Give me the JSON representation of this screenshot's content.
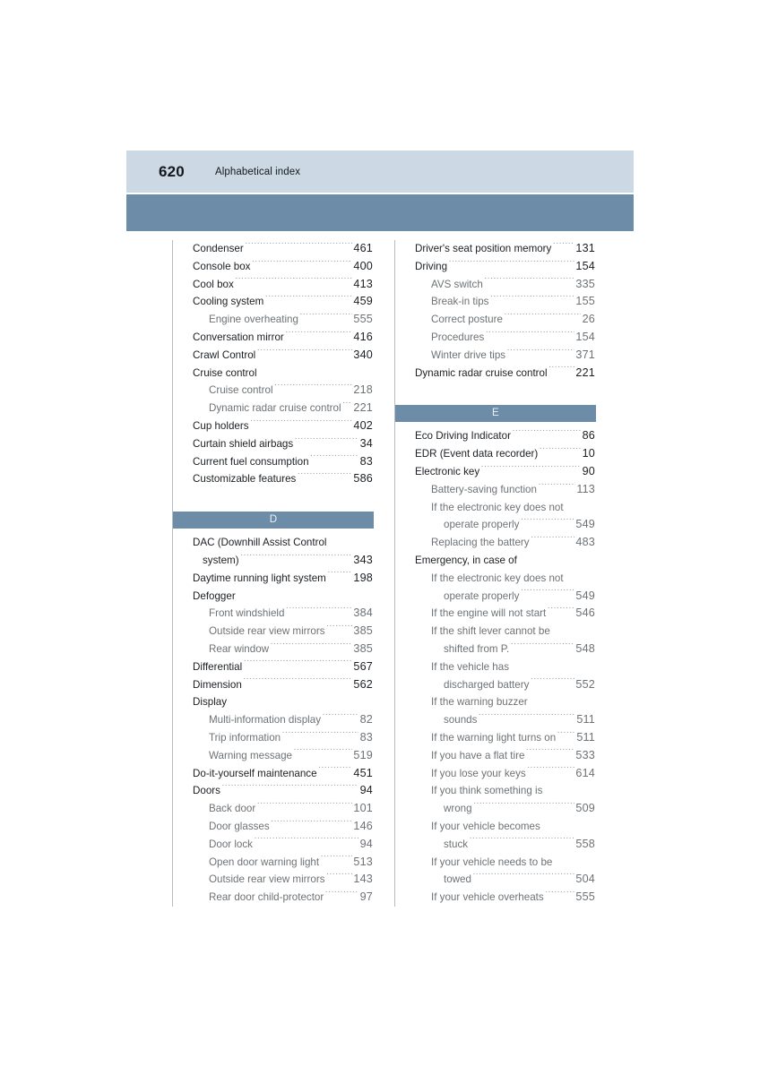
{
  "header": {
    "page_number": "620",
    "title": "Alphabetical index",
    "band_light_color": "#ccd9e4",
    "band_dark_color": "#6d8ca8"
  },
  "columns": [
    {
      "name": "left-column",
      "blocks": [
        {
          "type": "entry",
          "level": 1,
          "text": "Condenser",
          "page": "461"
        },
        {
          "type": "entry",
          "level": 1,
          "text": "Console box",
          "page": "400"
        },
        {
          "type": "entry",
          "level": 1,
          "text": "Cool box",
          "page": "413"
        },
        {
          "type": "entry",
          "level": 1,
          "text": "Cooling system",
          "page": "459"
        },
        {
          "type": "entry",
          "level": 2,
          "text": "Engine overheating",
          "page": "555"
        },
        {
          "type": "entry",
          "level": 1,
          "text": "Conversation mirror",
          "page": "416"
        },
        {
          "type": "entry",
          "level": 1,
          "text": "Crawl Control",
          "page": "340"
        },
        {
          "type": "entry",
          "level": 1,
          "text": "Cruise control",
          "page": ""
        },
        {
          "type": "entry",
          "level": 2,
          "text": "Cruise control",
          "page": "218"
        },
        {
          "type": "entry",
          "level": 2,
          "text": "Dynamic radar cruise control",
          "page": "221"
        },
        {
          "type": "entry",
          "level": 1,
          "text": "Cup holders",
          "page": "402"
        },
        {
          "type": "entry",
          "level": 1,
          "text": "Curtain shield airbags",
          "page": "34"
        },
        {
          "type": "entry",
          "level": 1,
          "text": "Current fuel consumption",
          "page": "83"
        },
        {
          "type": "entry",
          "level": 1,
          "text": "Customizable features",
          "page": "586"
        },
        {
          "type": "letter",
          "letter": "D"
        },
        {
          "type": "entry",
          "level": 1,
          "text": "DAC (Downhill Assist Control",
          "page": ""
        },
        {
          "type": "entry",
          "level": 1,
          "cont": 1,
          "text": "system)",
          "page": "343"
        },
        {
          "type": "entry",
          "level": 1,
          "text": "Daytime running light system",
          "page": "198"
        },
        {
          "type": "entry",
          "level": 1,
          "text": "Defogger",
          "page": ""
        },
        {
          "type": "entry",
          "level": 2,
          "text": "Front windshield",
          "page": "384"
        },
        {
          "type": "entry",
          "level": 2,
          "text": "Outside rear view mirrors",
          "page": "385"
        },
        {
          "type": "entry",
          "level": 2,
          "text": "Rear window",
          "page": "385"
        },
        {
          "type": "entry",
          "level": 1,
          "text": "Differential",
          "page": "567"
        },
        {
          "type": "entry",
          "level": 1,
          "text": "Dimension",
          "page": "562"
        },
        {
          "type": "entry",
          "level": 1,
          "text": "Display",
          "page": ""
        },
        {
          "type": "entry",
          "level": 2,
          "text": "Multi-information display",
          "page": "82"
        },
        {
          "type": "entry",
          "level": 2,
          "text": "Trip information",
          "page": "83"
        },
        {
          "type": "entry",
          "level": 2,
          "text": "Warning message",
          "page": "519"
        },
        {
          "type": "entry",
          "level": 1,
          "text": "Do-it-yourself maintenance",
          "page": "451"
        },
        {
          "type": "entry",
          "level": 1,
          "text": "Doors",
          "page": "94"
        },
        {
          "type": "entry",
          "level": 2,
          "text": "Back door",
          "page": "101"
        },
        {
          "type": "entry",
          "level": 2,
          "text": "Door glasses",
          "page": "146"
        },
        {
          "type": "entry",
          "level": 2,
          "text": "Door lock",
          "page": "94"
        },
        {
          "type": "entry",
          "level": 2,
          "text": "Open door warning light",
          "page": "513"
        },
        {
          "type": "entry",
          "level": 2,
          "text": "Outside rear view mirrors",
          "page": "143"
        },
        {
          "type": "entry",
          "level": 2,
          "text": "Rear door child-protector",
          "page": "97"
        }
      ]
    },
    {
      "name": "right-column",
      "blocks": [
        {
          "type": "entry",
          "level": 1,
          "text": "Driver's seat position memory",
          "page": "131"
        },
        {
          "type": "entry",
          "level": 1,
          "text": "Driving",
          "page": "154"
        },
        {
          "type": "entry",
          "level": 2,
          "text": "AVS switch",
          "page": "335"
        },
        {
          "type": "entry",
          "level": 2,
          "text": "Break-in tips",
          "page": "155"
        },
        {
          "type": "entry",
          "level": 2,
          "text": "Correct posture",
          "page": "26"
        },
        {
          "type": "entry",
          "level": 2,
          "text": "Procedures",
          "page": "154"
        },
        {
          "type": "entry",
          "level": 2,
          "text": "Winter drive tips",
          "page": "371"
        },
        {
          "type": "entry",
          "level": 1,
          "text": "Dynamic radar cruise control",
          "page": "221"
        },
        {
          "type": "letter",
          "letter": "E"
        },
        {
          "type": "entry",
          "level": 1,
          "text": "Eco Driving Indicator",
          "page": "86"
        },
        {
          "type": "entry",
          "level": 1,
          "text": "EDR (Event data recorder)",
          "page": "10"
        },
        {
          "type": "entry",
          "level": 1,
          "text": "Electronic key",
          "page": "90"
        },
        {
          "type": "entry",
          "level": 2,
          "text": "Battery-saving function",
          "page": "113"
        },
        {
          "type": "entry",
          "level": 2,
          "text": "If the electronic key does not",
          "page": ""
        },
        {
          "type": "entry",
          "level": 2,
          "cont": 2,
          "text": "operate properly",
          "page": "549"
        },
        {
          "type": "entry",
          "level": 2,
          "text": "Replacing the battery",
          "page": "483"
        },
        {
          "type": "entry",
          "level": 1,
          "text": "Emergency, in case of",
          "page": ""
        },
        {
          "type": "entry",
          "level": 2,
          "text": "If the electronic key does not",
          "page": ""
        },
        {
          "type": "entry",
          "level": 2,
          "cont": 2,
          "text": "operate properly",
          "page": "549"
        },
        {
          "type": "entry",
          "level": 2,
          "text": "If the engine will not start",
          "page": "546"
        },
        {
          "type": "entry",
          "level": 2,
          "text": "If the shift lever cannot be",
          "page": ""
        },
        {
          "type": "entry",
          "level": 2,
          "cont": 2,
          "text": "shifted from P.",
          "page": "548"
        },
        {
          "type": "entry",
          "level": 2,
          "text": "If the vehicle has",
          "page": ""
        },
        {
          "type": "entry",
          "level": 2,
          "cont": 2,
          "text": "discharged battery",
          "page": "552"
        },
        {
          "type": "entry",
          "level": 2,
          "text": "If the warning buzzer",
          "page": ""
        },
        {
          "type": "entry",
          "level": 2,
          "cont": 2,
          "text": "sounds",
          "page": "511"
        },
        {
          "type": "entry",
          "level": 2,
          "text": "If the warning light turns on",
          "page": "511"
        },
        {
          "type": "entry",
          "level": 2,
          "text": "If you have a flat tire",
          "page": "533"
        },
        {
          "type": "entry",
          "level": 2,
          "text": "If you lose your keys",
          "page": "614"
        },
        {
          "type": "entry",
          "level": 2,
          "text": "If you think something is",
          "page": ""
        },
        {
          "type": "entry",
          "level": 2,
          "cont": 2,
          "text": "wrong",
          "page": "509"
        },
        {
          "type": "entry",
          "level": 2,
          "text": "If your vehicle becomes",
          "page": ""
        },
        {
          "type": "entry",
          "level": 2,
          "cont": 2,
          "text": "stuck",
          "page": "558"
        },
        {
          "type": "entry",
          "level": 2,
          "text": "If your vehicle needs to be",
          "page": ""
        },
        {
          "type": "entry",
          "level": 2,
          "cont": 2,
          "text": "towed",
          "page": "504"
        },
        {
          "type": "entry",
          "level": 2,
          "text": "If your vehicle overheats",
          "page": "555"
        }
      ]
    }
  ]
}
